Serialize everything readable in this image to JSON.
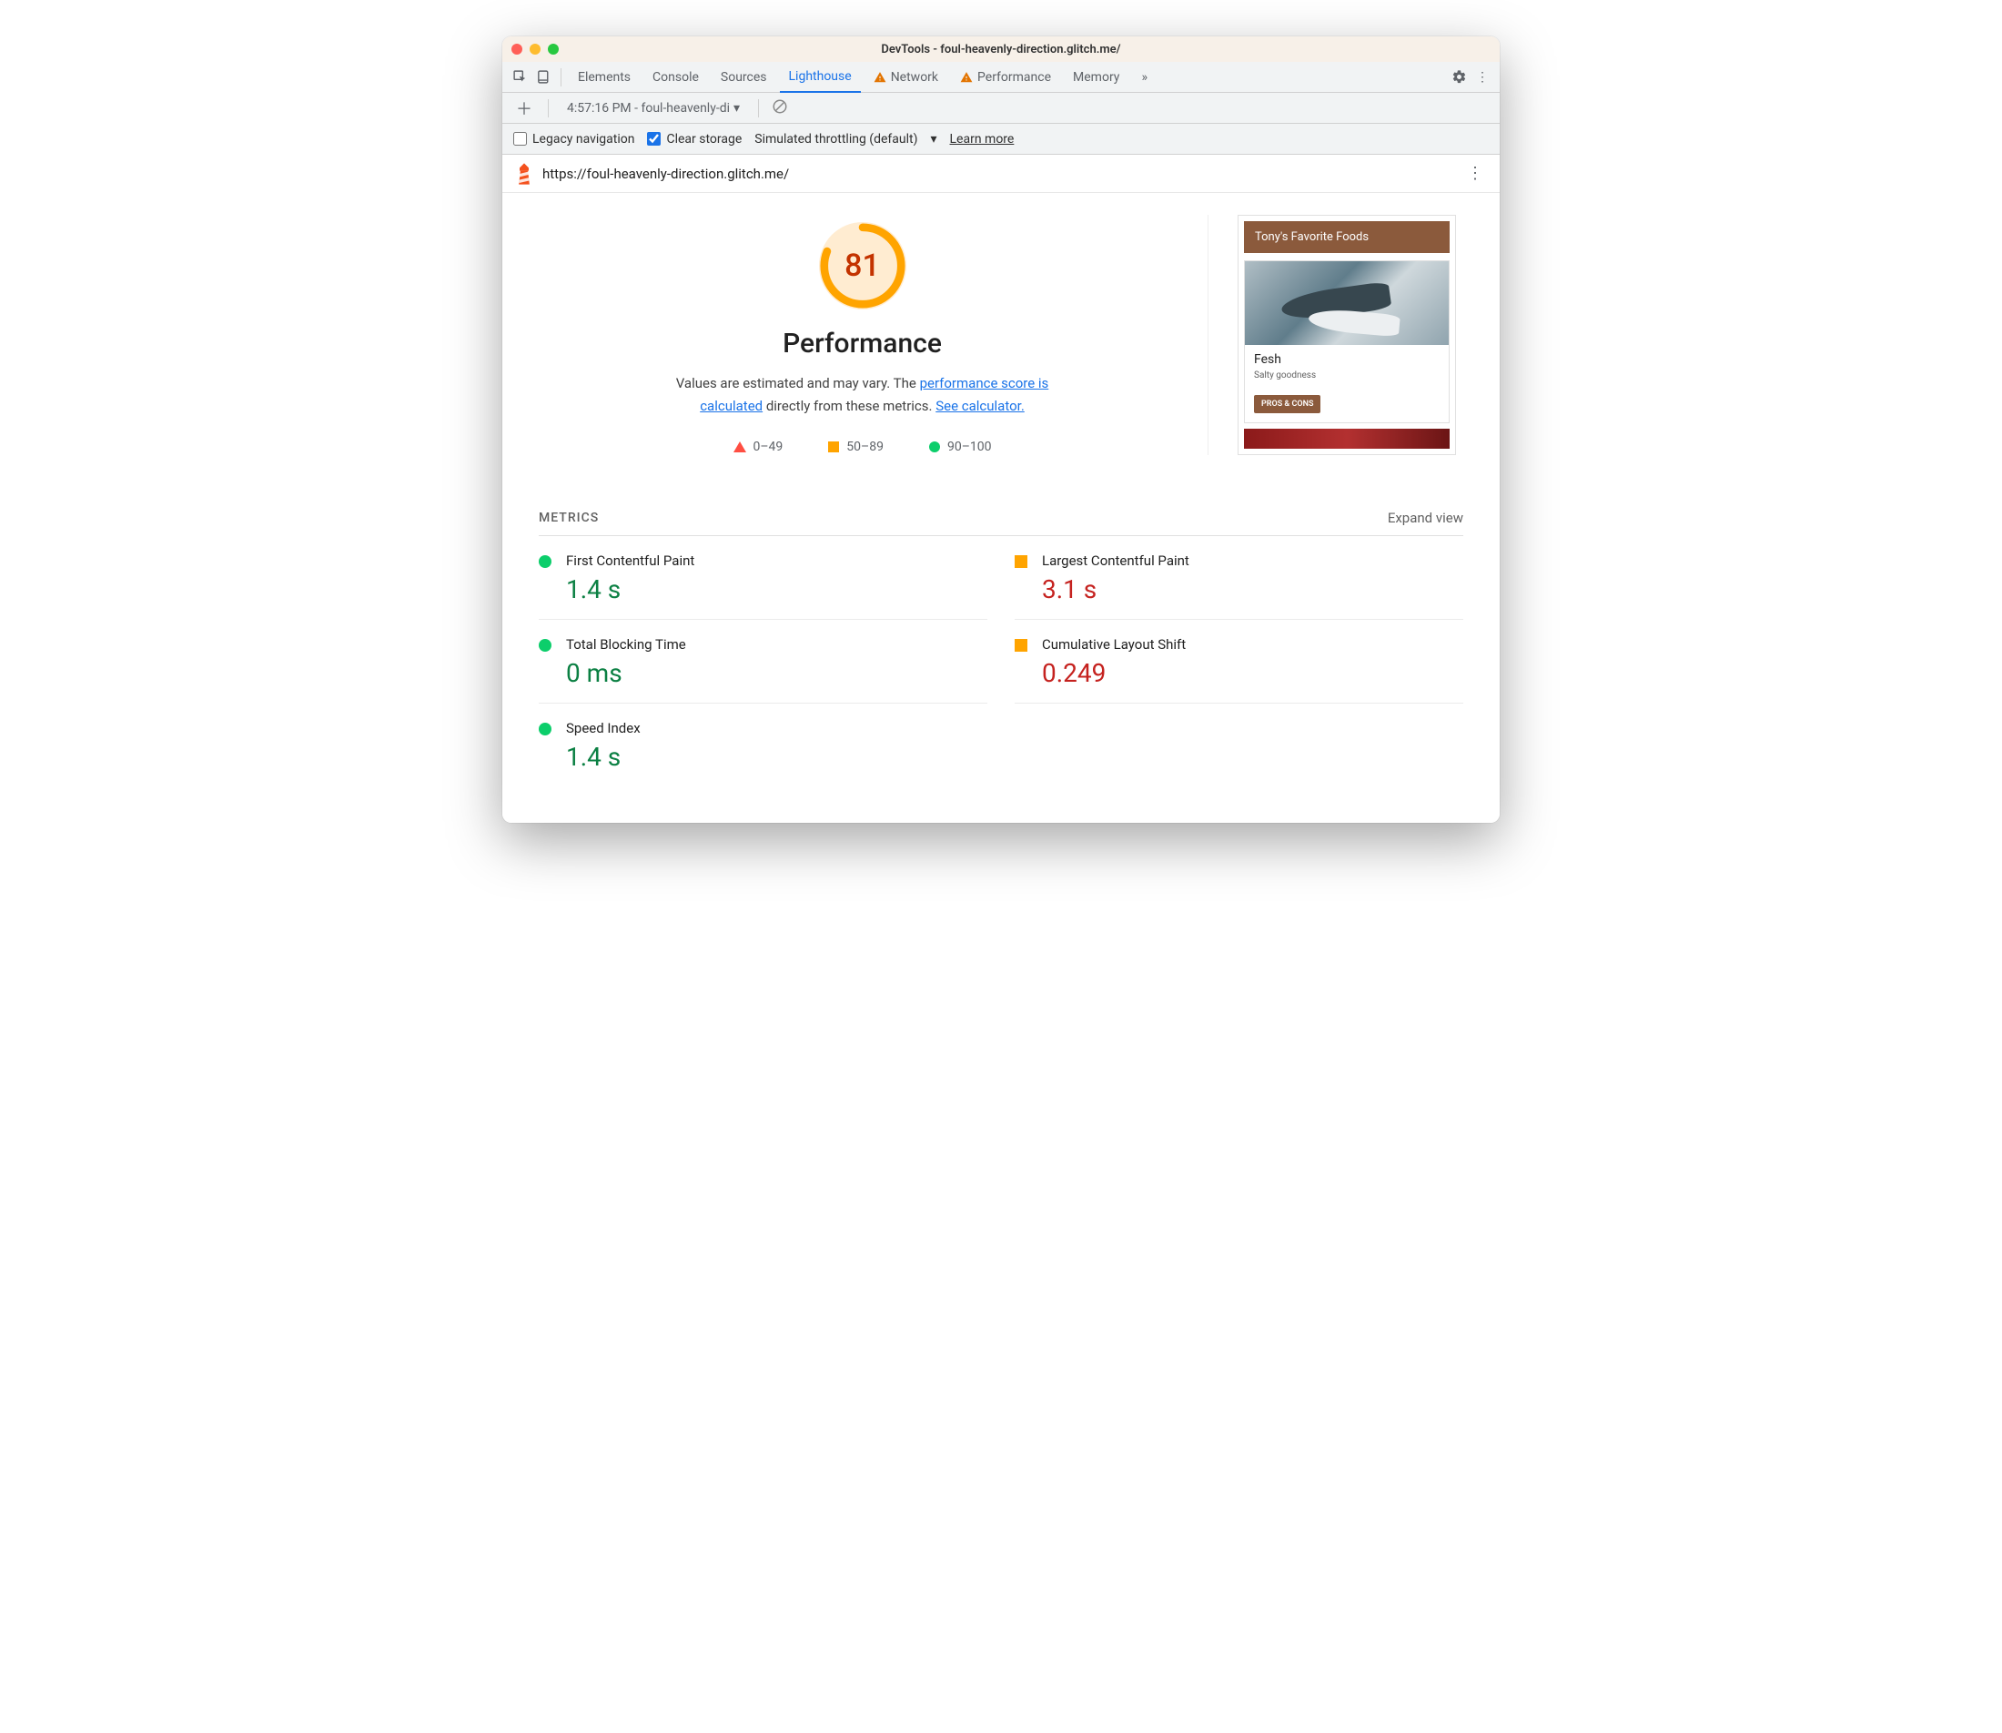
{
  "window": {
    "title": "DevTools - foul-heavenly-direction.glitch.me/"
  },
  "tabs": {
    "elements": "Elements",
    "console": "Console",
    "sources": "Sources",
    "lighthouse": "Lighthouse",
    "network": "Network",
    "performance": "Performance",
    "memory": "Memory"
  },
  "subtoolbar": {
    "report_label": "4:57:16 PM - foul-heavenly-di"
  },
  "options": {
    "legacy": "Legacy navigation",
    "clear_storage": "Clear storage",
    "throttling": "Simulated throttling (default)",
    "learn_more": "Learn more"
  },
  "report": {
    "url": "https://foul-heavenly-direction.glitch.me/",
    "score": "81",
    "score_title": "Performance",
    "desc_pre": "Values are estimated and may vary. The ",
    "desc_link1": "performance score is calculated",
    "desc_mid": " directly from these metrics. ",
    "desc_link2": "See calculator.",
    "legend": {
      "fail": "0–49",
      "avg": "50–89",
      "pass": "90–100"
    }
  },
  "preview": {
    "header": "Tony's Favorite Foods",
    "card_title": "Fesh",
    "card_sub": "Salty goodness",
    "card_btn": "PROS & CONS"
  },
  "metrics": {
    "title": "METRICS",
    "expand": "Expand view",
    "items": [
      {
        "label": "First Contentful Paint",
        "value": "1.4 s",
        "status": "green"
      },
      {
        "label": "Largest Contentful Paint",
        "value": "3.1 s",
        "status": "orange"
      },
      {
        "label": "Total Blocking Time",
        "value": "0 ms",
        "status": "green"
      },
      {
        "label": "Cumulative Layout Shift",
        "value": "0.249",
        "status": "orange"
      },
      {
        "label": "Speed Index",
        "value": "1.4 s",
        "status": "green"
      }
    ]
  }
}
